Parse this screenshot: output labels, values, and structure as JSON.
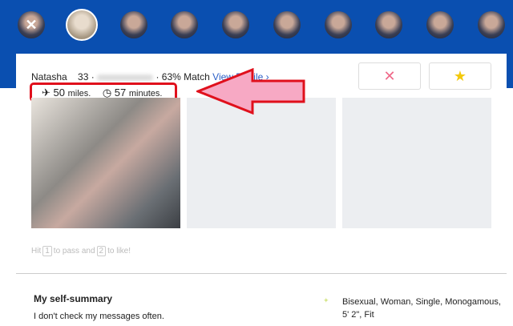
{
  "profile": {
    "name": "Natasha",
    "age": "33",
    "separator": "·",
    "match": "63% Match",
    "view_profile": "View Profile ›"
  },
  "stats": {
    "distance_value": "50",
    "distance_unit": "miles.",
    "time_value": "57",
    "time_unit": "minutes."
  },
  "buttons": {
    "pass_icon": "✕",
    "like_icon": "★"
  },
  "hint": {
    "pre": "Hit",
    "key1": "1",
    "mid": "to pass and",
    "key2": "2",
    "post": "to like!"
  },
  "summary": {
    "heading": "My self-summary",
    "text": "I don't check my messages often."
  },
  "details": {
    "text": "Bisexual, Woman, Single, Monogamous, 5' 2\", Fit"
  },
  "colors": {
    "header": "#0a4fb0",
    "annotation": "#e0101c",
    "arrow_fill": "#f7a9c4"
  }
}
